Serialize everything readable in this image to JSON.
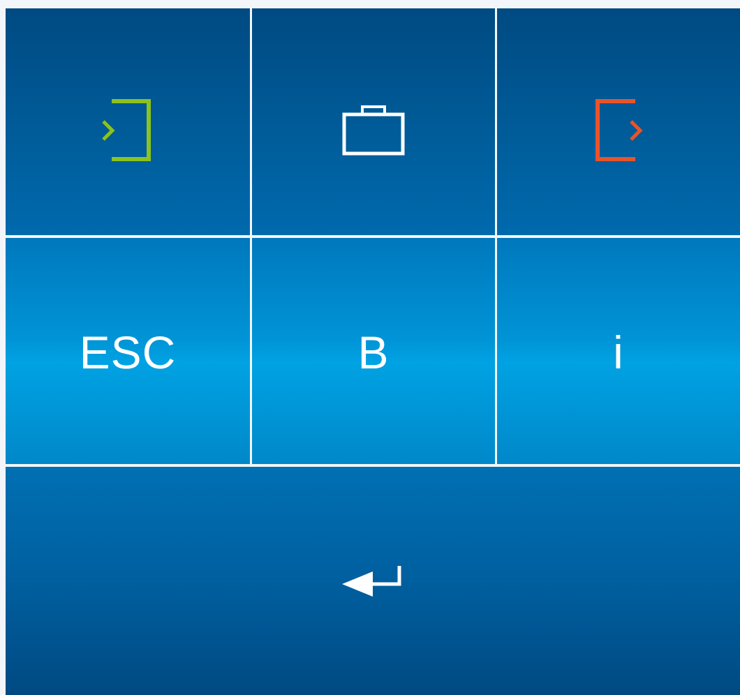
{
  "keypad": {
    "row1": [
      {
        "icon": "login-icon",
        "color": "#8cc21e"
      },
      {
        "icon": "briefcase-icon",
        "color": "#ffffff"
      },
      {
        "icon": "logout-icon",
        "color": "#e8542a"
      }
    ],
    "row2": [
      {
        "label": "ESC"
      },
      {
        "label": "B"
      },
      {
        "label": "i"
      }
    ],
    "row3": {
      "icon": "enter-icon",
      "color": "#ffffff"
    }
  }
}
